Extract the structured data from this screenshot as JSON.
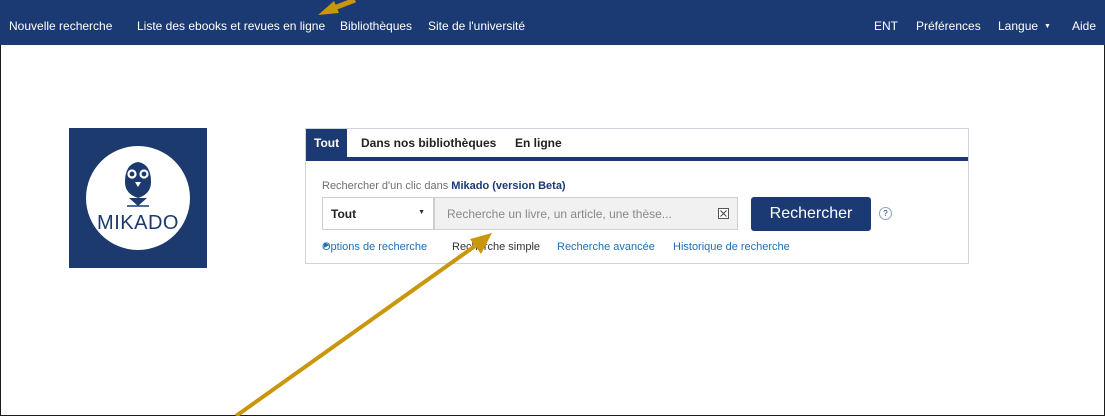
{
  "nav": {
    "left": [
      "Nouvelle recherche",
      "Liste des ebooks et revues en ligne",
      "Bibliothèques",
      "Site de l'université"
    ],
    "right": {
      "ent": "ENT",
      "preferences": "Préférences",
      "langue": "Langue",
      "aide": "Aide"
    }
  },
  "logo": {
    "text": "MIKADO"
  },
  "search": {
    "tabs": [
      "Tout",
      "Dans nos bibliothèques",
      "En ligne"
    ],
    "intro_prefix": "Rechercher d'un clic dans",
    "intro_brand": "Mikado (version Beta)",
    "scope_value": "Tout",
    "placeholder": "Recherche un livre, un article, une thèse...",
    "button": "Rechercher",
    "help": "?",
    "links": {
      "options": "Options de recherche",
      "simple": "Recherche simple",
      "advanced": "Recherche avancée",
      "history": "Historique de recherche"
    }
  },
  "colors": {
    "nav_bg": "#1b3a73",
    "accent": "#1b3a73",
    "link": "#1f6fb5",
    "annotation_arrow": "#c9960c"
  }
}
